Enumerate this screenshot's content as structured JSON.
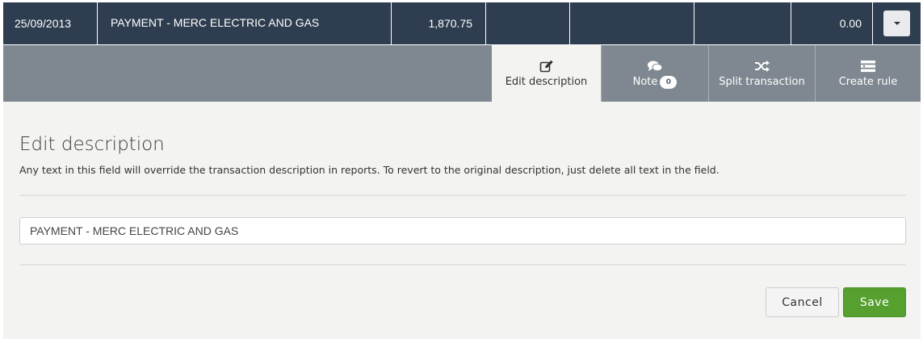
{
  "transaction": {
    "date": "25/09/2013",
    "description": "PAYMENT - MERC ELECTRIC AND GAS",
    "amount": "1,870.75",
    "balance": "0.00",
    "dropdown_icon": "caret-down-icon"
  },
  "tabs": [
    {
      "label": "Edit description",
      "icon": "edit-icon",
      "active": true
    },
    {
      "label": "Note",
      "icon": "comment-icon",
      "badge": "0"
    },
    {
      "label": "Split transaction",
      "icon": "shuffle-icon"
    },
    {
      "label": "Create rule",
      "icon": "list-icon"
    }
  ],
  "panel": {
    "title": "Edit description",
    "help": "Any text in this field will override the transaction description in reports. To revert to the original description, just delete all text in the field.",
    "input_value": "PAYMENT - MERC ELECTRIC AND GAS",
    "cancel_label": "Cancel",
    "save_label": "Save"
  },
  "colors": {
    "row_bg": "#2e3e50",
    "tabbar_bg": "#7f8890",
    "panel_bg": "#f3f3f1",
    "save_green": "#55a02e"
  }
}
